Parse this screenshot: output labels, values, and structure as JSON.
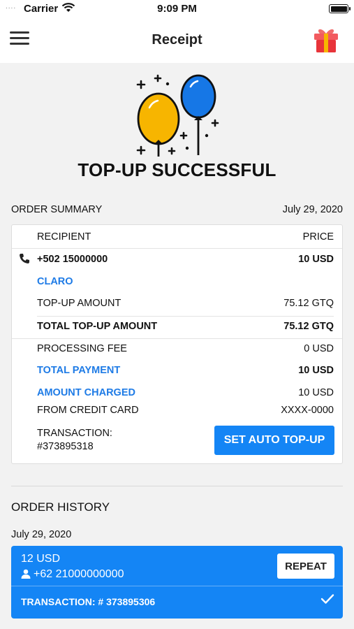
{
  "status_bar": {
    "signal": "....",
    "carrier": "Carrier",
    "time": "9:09 PM"
  },
  "nav": {
    "title": "Receipt"
  },
  "hero": {
    "headline": "TOP-UP SUCCESSFUL"
  },
  "summary": {
    "label": "ORDER SUMMARY",
    "date": "July 29, 2020",
    "header": {
      "recipient": "RECIPIENT",
      "price": "PRICE"
    },
    "phone": "+502 15000000",
    "price": "10 USD",
    "operator": "CLARO",
    "topup_amount_label": "TOP-UP AMOUNT",
    "topup_amount": "75.12 GTQ",
    "total_topup_label": "TOTAL TOP-UP AMOUNT",
    "total_topup": "75.12 GTQ",
    "fee_label": "PROCESSING FEE",
    "fee": "0 USD",
    "total_payment_label": "TOTAL PAYMENT",
    "total_payment": "10 USD",
    "charged_label": "AMOUNT CHARGED",
    "charged": "10 USD",
    "card_label": "FROM CREDIT CARD",
    "card": "XXXX-0000",
    "transaction_label": "TRANSACTION:",
    "transaction": "#373895318",
    "auto_topup_button": "SET AUTO TOP-UP"
  },
  "history": {
    "label": "ORDER HISTORY",
    "date": "July 29, 2020",
    "items": [
      {
        "amount": "12 USD",
        "recipient": "+62 21000000000",
        "repeat_button": "REPEAT",
        "transaction": "TRANSACTION: # 373895306"
      }
    ]
  },
  "colors": {
    "accent": "#1485f5",
    "link": "#1e7be6",
    "balloon_yellow": "#f7b500",
    "balloon_blue": "#1677e6",
    "gift_red": "#e8343a"
  },
  "icons": [
    "menu-icon",
    "gift-icon",
    "balloons-illustration",
    "phone-icon",
    "person-icon",
    "check-icon",
    "wifi-icon",
    "battery-icon"
  ]
}
